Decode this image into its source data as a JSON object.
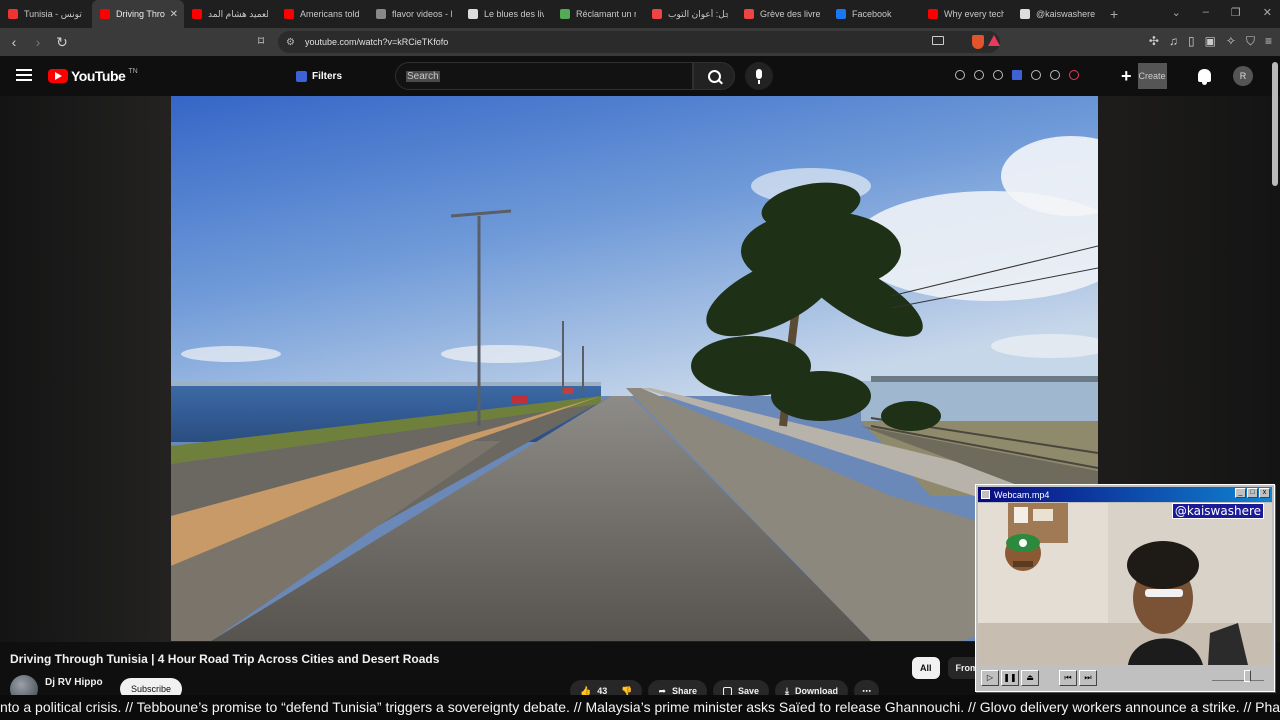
{
  "browser": {
    "tabs": [
      {
        "title": "Tunisia - تونس",
        "color": "#e33"
      },
      {
        "title": "Driving Thro",
        "color": "#f00"
      },
      {
        "title": "العميد هشام المد",
        "color": "#f00"
      },
      {
        "title": "Americans told t",
        "color": "#f00"
      },
      {
        "title": "flavor videos - D",
        "color": "#888"
      },
      {
        "title": "Le blues des livre",
        "color": "#ddd"
      },
      {
        "title": "Réclamant un re",
        "color": "#5a5"
      },
      {
        "title": "عاجل: أعوان التوب",
        "color": "#e44"
      },
      {
        "title": "Grève des livreu",
        "color": "#e44"
      },
      {
        "title": "Facebook",
        "color": "#1877f2"
      },
      {
        "title": "Why every tech",
        "color": "#f00"
      },
      {
        "title": "@kaiswashere -",
        "color": "#ddd"
      }
    ],
    "url": "youtube.com/watch?v=kRCieTKfofo"
  },
  "youtube": {
    "logo_text": "YouTube",
    "logo_badge": "TN",
    "filters_label": "Filters",
    "search_placeholder": "Search",
    "create_label": "Create",
    "avatar_initial": "R"
  },
  "video": {
    "title": "Driving Through Tunisia | 4 Hour Road Trip Across Cities and Desert Roads",
    "channel": "Dj RV Hippo",
    "subscribe_label": "Subscribe",
    "likes": "43",
    "share_label": "Share",
    "save_label": "Save",
    "download_label": "Download"
  },
  "chips": [
    "All",
    "From"
  ],
  "webcam": {
    "window_title": "Webcam.mp4",
    "handle": "@kaiswashere"
  },
  "ticker_text": "nto a political crisis. // Tebboune’s promise to “defend Tunisia” triggers a sovereignty debate. // Malaysia’s prime minister asks Saïed to release Ghannouchi. // Glovo delivery workers announce a strike. // Phar"
}
